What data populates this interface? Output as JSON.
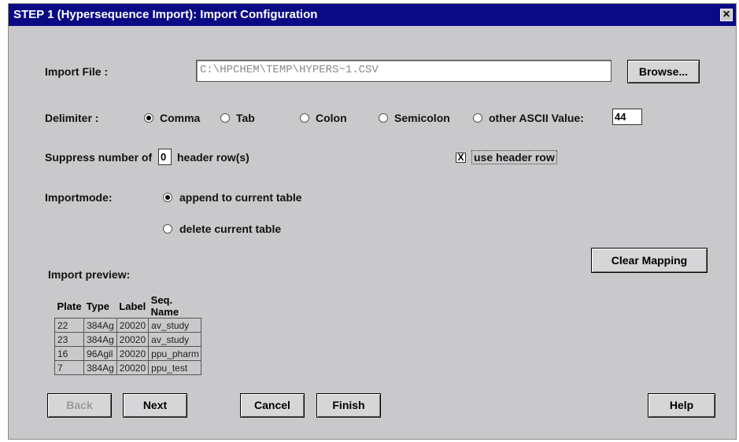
{
  "window": {
    "title": "STEP 1 (Hypersequence Import):  Import Configuration",
    "close_glyph": "✕"
  },
  "import_file": {
    "label": "Import File :",
    "value": "C:\\HPCHEM\\TEMP\\HYPERS~1.CSV",
    "browse_label": "Browse..."
  },
  "delimiter": {
    "label": "Delimiter :",
    "options": [
      {
        "label": "Comma",
        "selected": true
      },
      {
        "label": "Tab",
        "selected": false
      },
      {
        "label": "Colon",
        "selected": false
      },
      {
        "label": "Semicolon",
        "selected": false
      },
      {
        "label": "other ASCII Value:",
        "selected": false
      }
    ],
    "ascii_value": "44"
  },
  "suppress": {
    "prefix": "Suppress number of",
    "value": "0",
    "suffix": "header row(s)"
  },
  "use_header_row": {
    "label": "use header row",
    "checked": true,
    "glyph": "X"
  },
  "importmode": {
    "label": "Importmode:",
    "options": [
      {
        "label": "append to current table",
        "selected": true
      },
      {
        "label": "delete current table",
        "selected": false
      }
    ]
  },
  "clear_mapping_label": "Clear Mapping",
  "preview": {
    "label": "Import preview:",
    "columns": [
      "Plate",
      "Type",
      "Label",
      "Seq. Name"
    ],
    "rows": [
      [
        "22",
        "384Ag",
        "20020",
        "av_study"
      ],
      [
        "23",
        "384Ag",
        "20020",
        "av_study"
      ],
      [
        "16",
        "96Agil",
        "20020",
        "ppu_pharm"
      ],
      [
        "7",
        "384Ag",
        "20020",
        "ppu_test"
      ]
    ]
  },
  "buttons": {
    "back": "Back",
    "next": "Next",
    "cancel": "Cancel",
    "finish": "Finish",
    "help": "Help"
  }
}
